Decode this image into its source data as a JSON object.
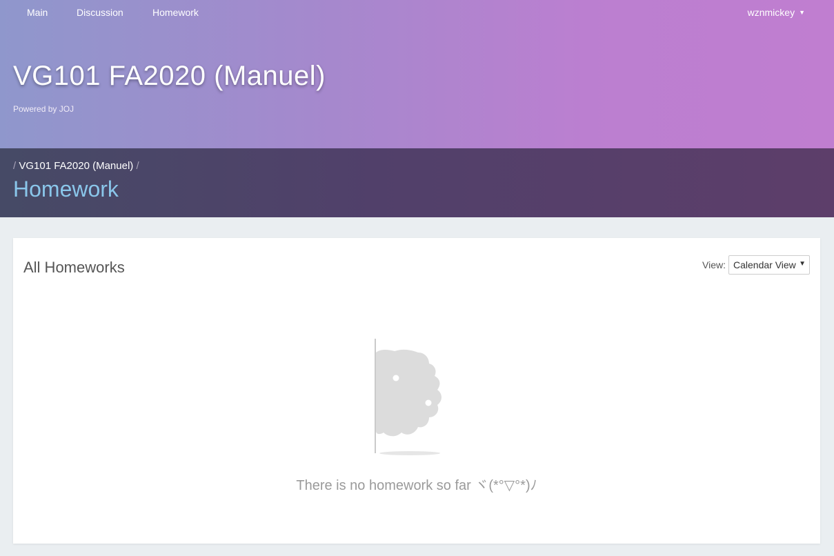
{
  "nav": {
    "items": [
      {
        "label": "Main"
      },
      {
        "label": "Discussion"
      },
      {
        "label": "Homework"
      }
    ],
    "user": "wznmickey"
  },
  "hero": {
    "title": "VG101 FA2020 (Manuel)",
    "subtitle": "Powered by JOJ"
  },
  "breadcrumb": {
    "items": [
      "VG101 FA2020 (Manuel)"
    ]
  },
  "page": {
    "title": "Homework"
  },
  "card": {
    "title": "All Homeworks",
    "view_label": "View:",
    "view_selected": "Calendar View",
    "empty_message": "There is no homework so far ヾ(*°▽°*)ﾉ"
  },
  "colors": {
    "hero_gradient_start": "#8f97cc",
    "hero_gradient_end": "#c07ed0",
    "subheader_bg": "#51406a",
    "page_title": "#8ac6ea"
  }
}
